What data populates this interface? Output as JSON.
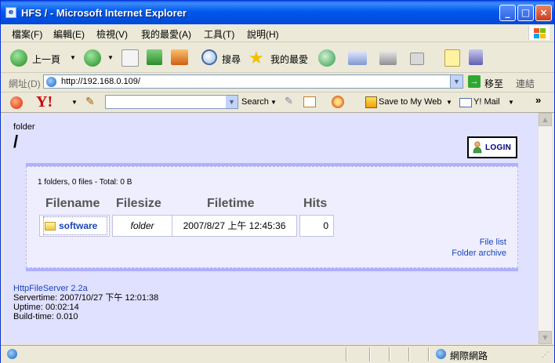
{
  "window": {
    "title": "HFS / - Microsoft Internet Explorer"
  },
  "menu": [
    "檔案(F)",
    "編輯(E)",
    "檢視(V)",
    "我的最愛(A)",
    "工具(T)",
    "說明(H)"
  ],
  "toolbar": {
    "back_label": "上一頁",
    "search_label": "搜尋",
    "favorites_label": "我的最愛"
  },
  "address": {
    "label": "網址(D)",
    "url": "http://192.168.0.109/",
    "go_label": "移至",
    "links_label": "連結"
  },
  "yahoo_bar": {
    "search_label": "Search",
    "save_label": "Save to My Web",
    "mail_label": "Y! Mail",
    "more": "»"
  },
  "page": {
    "folder_label": "folder",
    "folder_path": "/",
    "login_label": "LOGIN",
    "summary": "1 folders, 0 files - Total: 0 B",
    "columns": [
      "Filename",
      "Filesize",
      "Filetime",
      "Hits"
    ],
    "rows": [
      {
        "name": "software",
        "size": "folder",
        "time": "2007/8/27 上午 12:45:36",
        "hits": "0"
      }
    ],
    "links": [
      "File list",
      "Folder archive"
    ]
  },
  "footer": {
    "server": "HttpFileServer 2.2a",
    "servertime": "Servertime: 2007/10/27 下午 12:01:38",
    "uptime": "Uptime: 00:02:14",
    "buildtime": "Build-time: 0.010"
  },
  "status": {
    "zone": "網際網路"
  }
}
